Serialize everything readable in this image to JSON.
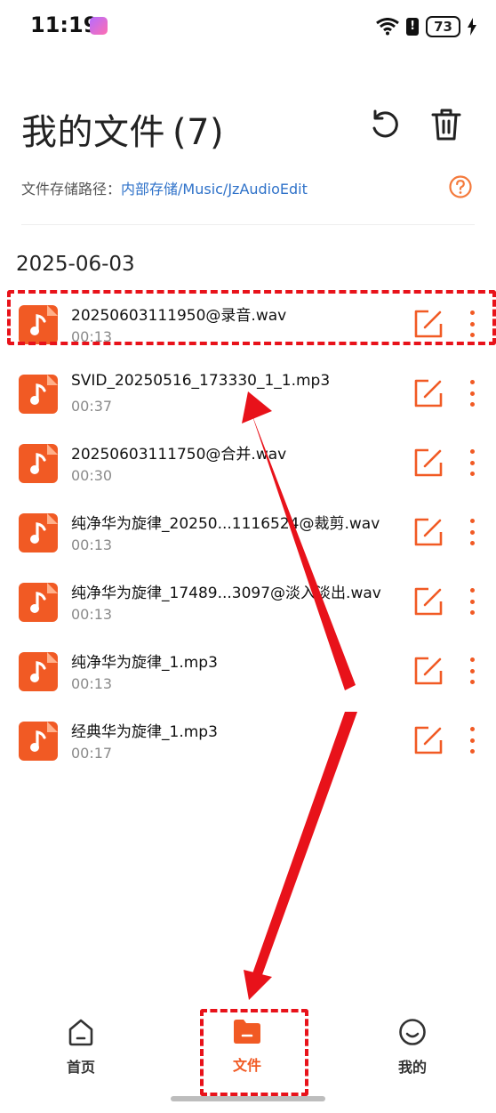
{
  "status_bar": {
    "time": "11:19",
    "battery": "73"
  },
  "header": {
    "title": "我的文件",
    "count": "(7)"
  },
  "storage": {
    "label": "文件存储路径：",
    "path": "内部存储/Music/JzAudioEdit"
  },
  "date_group": "2025-06-03",
  "files": [
    {
      "name": "20250603111950@录音.wav",
      "duration": "00:13"
    },
    {
      "name": "SVID_20250516_173330_1_1.mp3",
      "duration": "00:37"
    },
    {
      "name": "20250603111750@合并.wav",
      "duration": "00:30"
    },
    {
      "name": "纯净华为旋律_20250...1116524@裁剪.wav",
      "duration": "00:13"
    },
    {
      "name": "纯净华为旋律_17489...3097@淡入淡出.wav",
      "duration": "00:13"
    },
    {
      "name": "纯净华为旋律_1.mp3",
      "duration": "00:13"
    },
    {
      "name": "经典华为旋律_1.mp3",
      "duration": "00:17"
    }
  ],
  "tabs": [
    {
      "label": "首页",
      "icon": "home-icon",
      "active": false
    },
    {
      "label": "文件",
      "icon": "folder-icon",
      "active": true
    },
    {
      "label": "我的",
      "icon": "smiley-icon",
      "active": false
    }
  ],
  "colors": {
    "accent": "#f15a24",
    "link": "#2f72c9",
    "annotation": "#e8121a"
  }
}
